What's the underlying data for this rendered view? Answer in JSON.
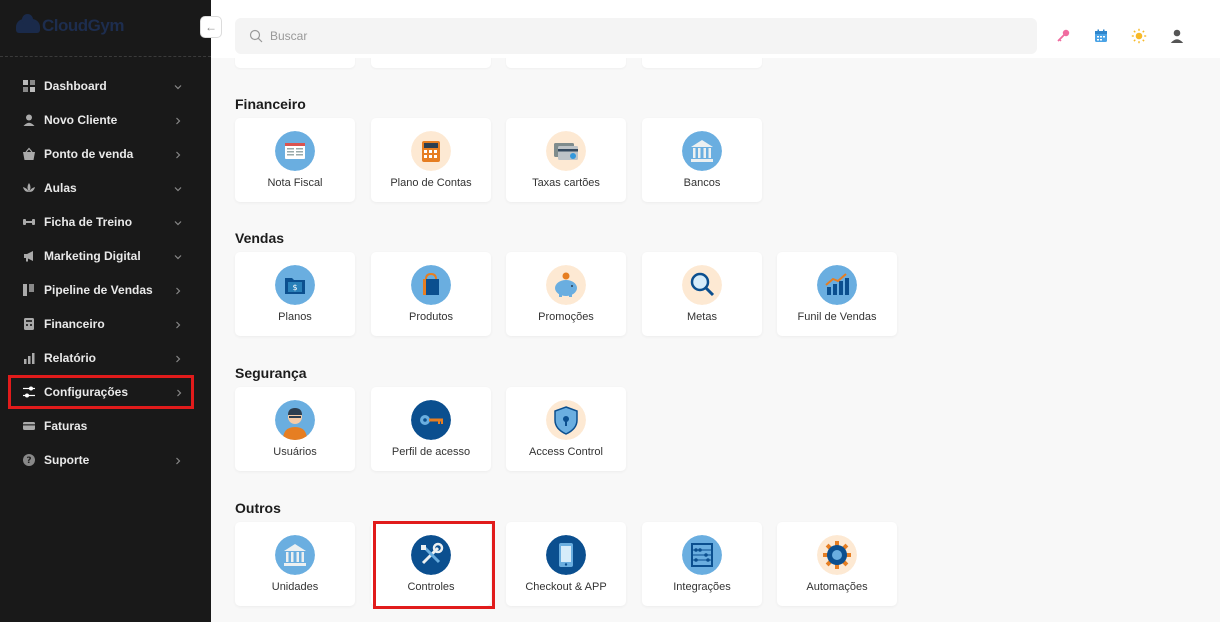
{
  "app": {
    "logo_text": "CloudGym"
  },
  "sidebar": {
    "collapse_icon": "arrow-left-icon",
    "items": [
      {
        "label": "Dashboard",
        "icon": "grid-icon",
        "chevron": "down"
      },
      {
        "label": "Novo Cliente",
        "icon": "user-icon",
        "chevron": "right"
      },
      {
        "label": "Ponto de venda",
        "icon": "basket-icon",
        "chevron": "right"
      },
      {
        "label": "Aulas",
        "icon": "lotus-icon",
        "chevron": "down"
      },
      {
        "label": "Ficha de Treino",
        "icon": "dumbbell-icon",
        "chevron": "down"
      },
      {
        "label": "Marketing Digital",
        "icon": "megaphone-icon",
        "chevron": "down"
      },
      {
        "label": "Pipeline de Vendas",
        "icon": "pipeline-icon",
        "chevron": "right"
      },
      {
        "label": "Financeiro",
        "icon": "calculator-icon",
        "chevron": "right"
      },
      {
        "label": "Relatório",
        "icon": "bar-chart-icon",
        "chevron": "right"
      },
      {
        "label": "Configurações",
        "icon": "sliders-icon",
        "chevron": "right",
        "highlighted": true
      },
      {
        "label": "Faturas",
        "icon": "credit-card-icon",
        "chevron": ""
      },
      {
        "label": "Suporte",
        "icon": "help-icon",
        "chevron": "right"
      }
    ]
  },
  "header": {
    "search_placeholder": "Buscar",
    "icons": [
      "key-icon",
      "calendar-icon",
      "sun-icon",
      "user-icon"
    ]
  },
  "sections": [
    {
      "title": "Financeiro",
      "cards": [
        {
          "label": "Nota Fiscal",
          "icon": "invoice-icon"
        },
        {
          "label": "Plano de Contas",
          "icon": "calculator-icon"
        },
        {
          "label": "Taxas cartões",
          "icon": "card-fees-icon"
        },
        {
          "label": "Bancos",
          "icon": "bank-icon"
        }
      ]
    },
    {
      "title": "Vendas",
      "cards": [
        {
          "label": "Planos",
          "icon": "folder-plans-icon"
        },
        {
          "label": "Produtos",
          "icon": "shopping-bag-icon"
        },
        {
          "label": "Promoções",
          "icon": "piggy-bank-icon"
        },
        {
          "label": "Metas",
          "icon": "magnifier-icon"
        },
        {
          "label": "Funil de Vendas",
          "icon": "growth-chart-icon"
        }
      ]
    },
    {
      "title": "Segurança",
      "cards": [
        {
          "label": "Usuários",
          "icon": "person-icon"
        },
        {
          "label": "Perfil de acesso",
          "icon": "key-icon"
        },
        {
          "label": "Access Control",
          "icon": "shield-lock-icon"
        }
      ]
    },
    {
      "title": "Outros",
      "cards": [
        {
          "label": "Unidades",
          "icon": "bank-icon"
        },
        {
          "label": "Controles",
          "icon": "tools-icon",
          "highlighted": true
        },
        {
          "label": "Checkout & APP",
          "icon": "smartphone-icon"
        },
        {
          "label": "Integrações",
          "icon": "abacus-icon"
        },
        {
          "label": "Automações",
          "icon": "gear-icon"
        }
      ]
    }
  ],
  "colors": {
    "sidebar_bg": "#191919",
    "highlight": "#e11b1b",
    "icon_blue": "#6aaee0",
    "icon_peach": "#fde9d3",
    "icon_navy": "#0b4f8f"
  }
}
